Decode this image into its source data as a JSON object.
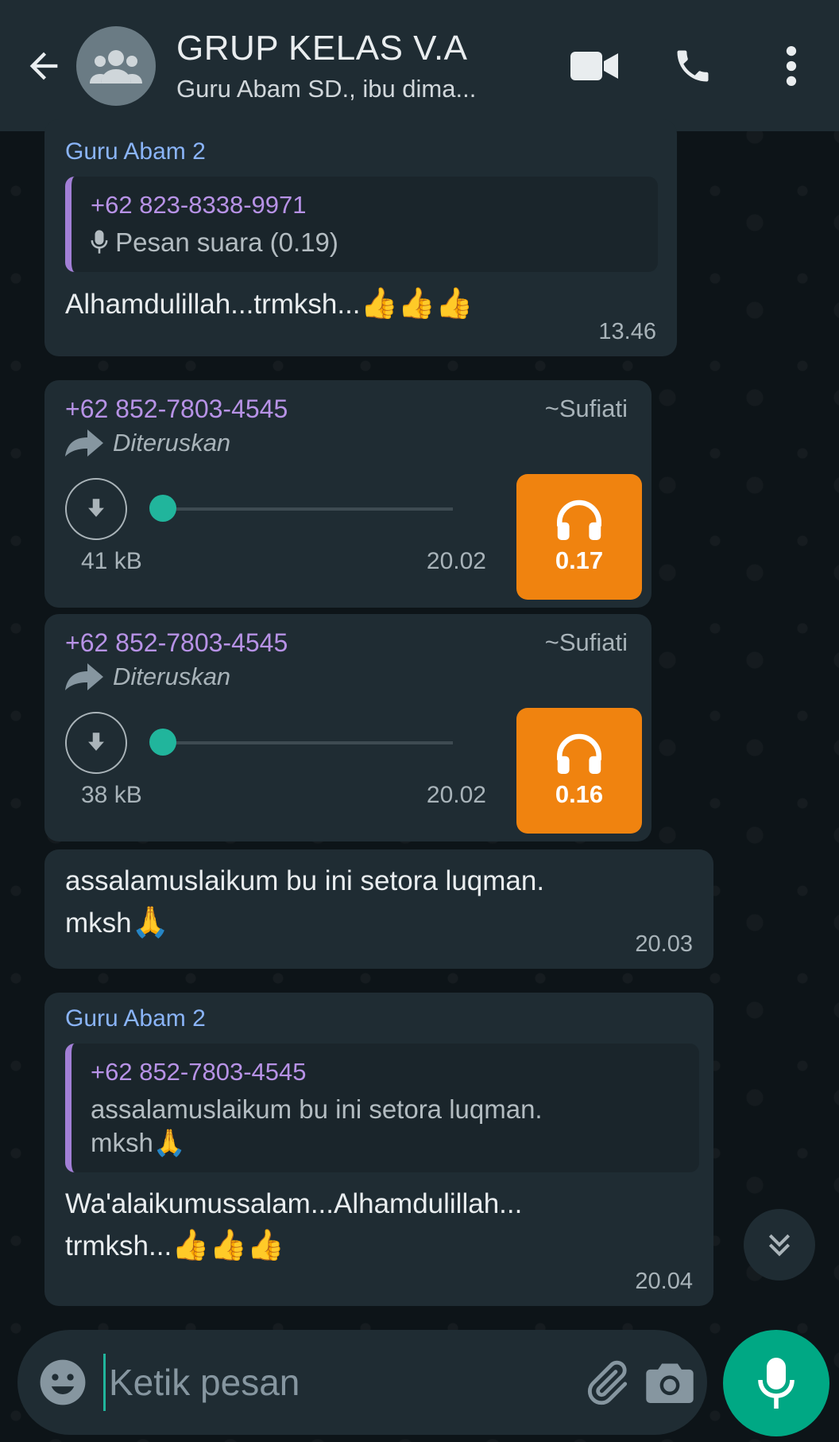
{
  "header": {
    "title": "GRUP KELAS V.A",
    "subtitle": "Guru Abam SD., ibu dima...",
    "icons": [
      "back-arrow-icon",
      "group-avatar-icon",
      "video-call-icon",
      "phone-icon",
      "more-options-icon"
    ]
  },
  "messages": [
    {
      "sender": "Guru Abam 2",
      "quote_phone": "+62 823-8338-9971",
      "quote_text": "Pesan suara (0.19)",
      "text": "Alhamdulillah...trmksh...",
      "emoji": "👍👍👍",
      "time": "13.46"
    },
    {
      "phone": "+62 852-7803-4545",
      "name": "~Sufiati",
      "forwarded": "Diteruskan",
      "size": "41 kB",
      "time": "20.02",
      "duration": "0.17"
    },
    {
      "phone": "+62 852-7803-4545",
      "name": "~Sufiati",
      "forwarded": "Diteruskan",
      "size": "38 kB",
      "time": "20.02",
      "duration": "0.16"
    },
    {
      "text_line1": "assalamuslaikum bu ini setora luqman.",
      "text_line2": "mksh",
      "emoji": "🙏",
      "time": "20.03"
    },
    {
      "sender": "Guru Abam 2",
      "quote_phone": "+62 852-7803-4545",
      "quote_line1": "assalamuslaikum bu ini setora luqman.",
      "quote_line2": "mksh",
      "quote_emoji": "🙏",
      "text_line1": "Wa'alaikumussalam...Alhamdulillah...",
      "text_line2": "trmksh...",
      "emoji": "👍👍👍",
      "time": "20.04"
    }
  ],
  "input": {
    "placeholder": "Ketik pesan"
  },
  "colors": {
    "header_bg": "#1f2c33",
    "bubble_bg": "#1f2c33",
    "accent_green": "#00a884",
    "audio_orange": "#f0830f",
    "quote_bar": "#a27fd6"
  }
}
